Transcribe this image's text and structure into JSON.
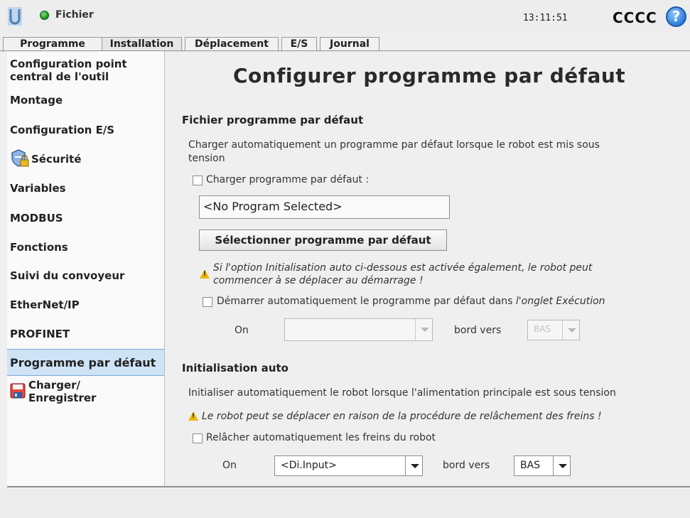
{
  "header": {
    "file_menu": "Fichier",
    "clock": "13:11:51",
    "robot_name": "CCCC",
    "help": "?"
  },
  "tabs": [
    {
      "label": "Programme"
    },
    {
      "label": "Installation"
    },
    {
      "label": "Déplacement"
    },
    {
      "label": "E/S"
    },
    {
      "label": "Journal"
    }
  ],
  "active_tab": "Installation",
  "sidebar": {
    "items": [
      {
        "label": "Configuration point central de l'outil"
      },
      {
        "label": "Montage"
      },
      {
        "label": "Configuration E/S"
      },
      {
        "label": "Sécurité",
        "icon": "shield-lock-icon"
      },
      {
        "label": "Variables"
      },
      {
        "label": "MODBUS"
      },
      {
        "label": "Fonctions"
      },
      {
        "label": "Suivi du convoyeur"
      },
      {
        "label": "EtherNet/IP"
      },
      {
        "label": "PROFINET"
      },
      {
        "label": "Programme par défaut"
      },
      {
        "label": "Charger/ Enregistrer",
        "icon": "floppy-disk-icon"
      }
    ],
    "selected": "Programme par défaut"
  },
  "main": {
    "title": "Configurer programme par défaut",
    "section1": {
      "heading": "Fichier programme par défaut",
      "description_line1": "Charger automatiquement un programme par défaut lorsque le robot est mis sous",
      "description_line2": "tension",
      "load_checkbox_label": "Charger programme par défaut :",
      "program_field_value": "<No Program Selected>",
      "select_button": "Sélectionner programme par défaut",
      "warning_line1": "Si l'option Initialisation auto ci-dessous est activée également, le robot peut",
      "warning_line2": "commencer à se déplacer au démarrage !",
      "autostart_label_prefix": "Démarrer automatiquement le programme par défaut dans ",
      "autostart_label_italic": "l'onglet Exécution",
      "on_label": "On",
      "input_value": "",
      "edge_label": "bord vers",
      "edge_value": "BAS"
    },
    "section2": {
      "heading": "Initialisation auto",
      "description": "Initialiser automatiquement le robot lorsque l'alimentation principale est sous tension",
      "warning": "Le robot peut se déplacer en raison de la procédure de relâchement des freins !",
      "brake_checkbox_label": "Relâcher automatiquement les freins du robot",
      "on_label": "On",
      "input_value": "<Di.Input>",
      "edge_label": "bord vers",
      "edge_value": "BAS"
    }
  },
  "colors": {
    "selected_item_bg": "#cfe3f7",
    "status_green": "#1a8a1a",
    "help_blue": "#2f7fd9",
    "warning_yellow": "#e8b800"
  }
}
